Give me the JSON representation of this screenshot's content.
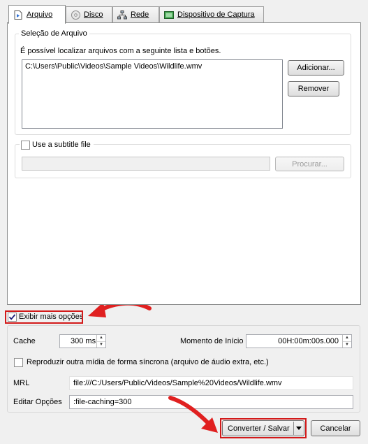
{
  "tabs": [
    {
      "label": "Arquivo",
      "icon": "file-icon"
    },
    {
      "label": "Disco",
      "icon": "disc-icon"
    },
    {
      "label": "Rede",
      "icon": "network-icon"
    },
    {
      "label": "Dispositivo de Captura",
      "icon": "capture-device-icon"
    }
  ],
  "file_selection": {
    "title": "Seleção de Arquivo",
    "description": "É possível localizar arquivos com a seguinte lista e botões.",
    "files": [
      "C:\\Users\\Public\\Videos\\Sample Videos\\Wildlife.wmv"
    ],
    "add_button": "Adicionar...",
    "remove_button": "Remover"
  },
  "subtitle": {
    "checkbox_label": "Use a subtitle file",
    "checked": false,
    "path_value": "",
    "browse_button": "Procurar..."
  },
  "show_more": {
    "label": "Exibir mais opções",
    "checked": true
  },
  "options": {
    "cache_label": "Cache",
    "cache_value": "300 ms",
    "start_label": "Momento de Início",
    "start_value": "00H:00m:00s.000",
    "sync_label": "Reproduzir outra mídia de forma síncrona (arquivo de áudio extra, etc.)",
    "sync_checked": false,
    "mrl_label": "MRL",
    "mrl_value": "file:///C:/Users/Public/Videos/Sample%20Videos/Wildlife.wmv",
    "edit_label": "Editar Opções",
    "edit_value": ":file-caching=300"
  },
  "footer": {
    "convert_button": "Converter / Salvar",
    "cancel_button": "Cancelar"
  },
  "colors": {
    "highlight": "#d21a1a"
  }
}
